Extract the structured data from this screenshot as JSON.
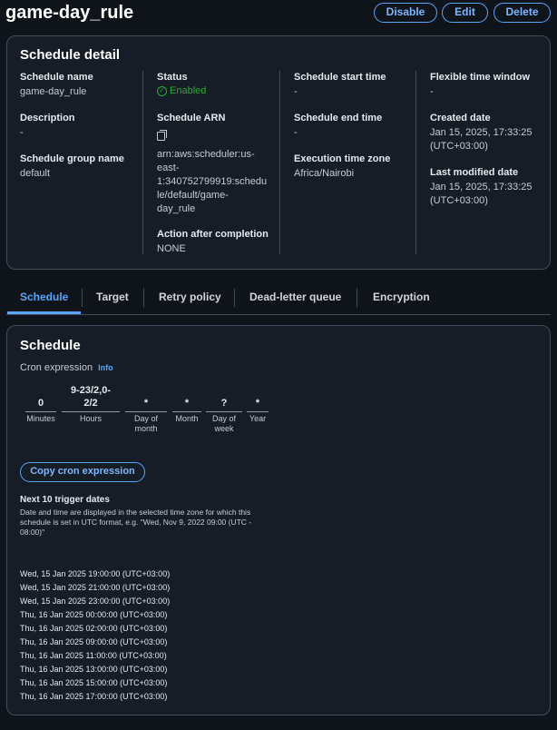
{
  "page": {
    "title": "game-day_rule",
    "buttons": {
      "disable": "Disable",
      "edit": "Edit",
      "delete": "Delete"
    }
  },
  "schedule_detail": {
    "title": "Schedule detail",
    "schedule_name": {
      "label": "Schedule name",
      "value": "game-day_rule"
    },
    "description": {
      "label": "Description",
      "value": "-"
    },
    "schedule_group_name": {
      "label": "Schedule group name",
      "value": "default"
    },
    "status": {
      "label": "Status",
      "value": "Enabled"
    },
    "schedule_arn": {
      "label": "Schedule ARN",
      "value_lines": [
        "arn:aws:scheduler:us-",
        "east-",
        "1:340752799919:schedu",
        "le/default/game-",
        "day_rule"
      ]
    },
    "action_after_completion": {
      "label": "Action after completion",
      "value": "NONE"
    },
    "schedule_start_time": {
      "label": "Schedule start time",
      "value": "-"
    },
    "schedule_end_time": {
      "label": "Schedule end time",
      "value": "-"
    },
    "execution_time_zone": {
      "label": "Execution time zone",
      "value": "Africa/Nairobi"
    },
    "flexible_time_window": {
      "label": "Flexible time window",
      "value": "-"
    },
    "created_date": {
      "label": "Created date",
      "value_lines": [
        "Jan 15, 2025, 17:33:25",
        "(UTC+03:00)"
      ]
    },
    "last_modified_date": {
      "label": "Last modified date",
      "value_lines": [
        "Jan 15, 2025, 17:33:25",
        "(UTC+03:00)"
      ]
    }
  },
  "tabs": [
    "Schedule",
    "Target",
    "Retry policy",
    "Dead-letter queue",
    "Encryption"
  ],
  "active_tab": "Schedule",
  "schedule_panel": {
    "title": "Schedule",
    "cron_label": "Cron expression",
    "info_link": "Info",
    "cron_fields": [
      {
        "value_lines": [
          "0"
        ],
        "name_lines": [
          "Minutes"
        ]
      },
      {
        "value_lines": [
          "9-23/2,0-",
          "2/2"
        ],
        "name_lines": [
          "Hours"
        ]
      },
      {
        "value_lines": [
          "*"
        ],
        "name_lines": [
          "Day of",
          "month"
        ]
      },
      {
        "value_lines": [
          "*"
        ],
        "name_lines": [
          "Month"
        ]
      },
      {
        "value_lines": [
          "?"
        ],
        "name_lines": [
          "Day of",
          "week"
        ]
      },
      {
        "value_lines": [
          "*"
        ],
        "name_lines": [
          "Year"
        ]
      }
    ],
    "copy_button": "Copy cron expression",
    "next_title": "Next 10 trigger dates",
    "next_description": "Date and time are displayed in the selected time zone for which this schedule is set in UTC format, e.g. \"Wed, Nov 9, 2022 09:00 (UTC - 08:00)\"",
    "trigger_dates": [
      "Wed, 15 Jan 2025 19:00:00 (UTC+03:00)",
      "Wed, 15 Jan 2025 21:00:00 (UTC+03:00)",
      "Wed, 15 Jan 2025 23:00:00 (UTC+03:00)",
      "Thu, 16 Jan 2025 00:00:00 (UTC+03:00)",
      "Thu, 16 Jan 2025 02:00:00 (UTC+03:00)",
      "Thu, 16 Jan 2025 09:00:00 (UTC+03:00)",
      "Thu, 16 Jan 2025 11:00:00 (UTC+03:00)",
      "Thu, 16 Jan 2025 13:00:00 (UTC+03:00)",
      "Thu, 16 Jan 2025 15:00:00 (UTC+03:00)",
      "Thu, 16 Jan 2025 17:00:00 (UTC+03:00)"
    ]
  },
  "colors": {
    "accent": "#54a6ff",
    "success": "#29ad32",
    "background": "#0f141a",
    "panel": "#161d26",
    "border": "#414d5c"
  }
}
